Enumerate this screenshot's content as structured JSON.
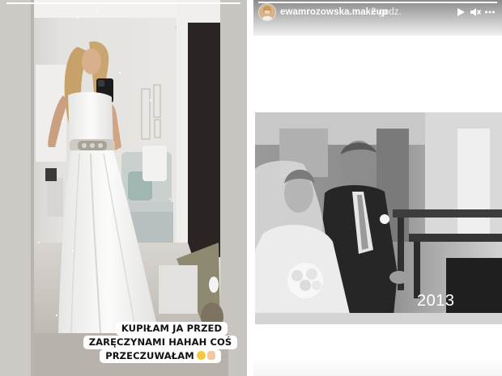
{
  "left_story": {
    "caption": {
      "line1": "KUPIŁAM JA PRZED",
      "line2": "ZARĘCZYNAMI HAHAH COŚ",
      "line3": "PRZECZUWAŁAM",
      "emojis": [
        "grinning-sweat-emoji",
        "thumbs-up-emoji"
      ]
    },
    "progress": 1.0
  },
  "right_story": {
    "username": "ewamrozowska.makeup",
    "timestamp": "2 godz.",
    "controls": [
      "play-icon",
      "mute-icon",
      "more-icon"
    ],
    "photo_overlay_text": "2013",
    "progress": 1.0
  },
  "colors": {
    "caption_bg": "#ffffff",
    "topbar_dark": "#8a8a8a",
    "text_light": "#ffffff"
  }
}
